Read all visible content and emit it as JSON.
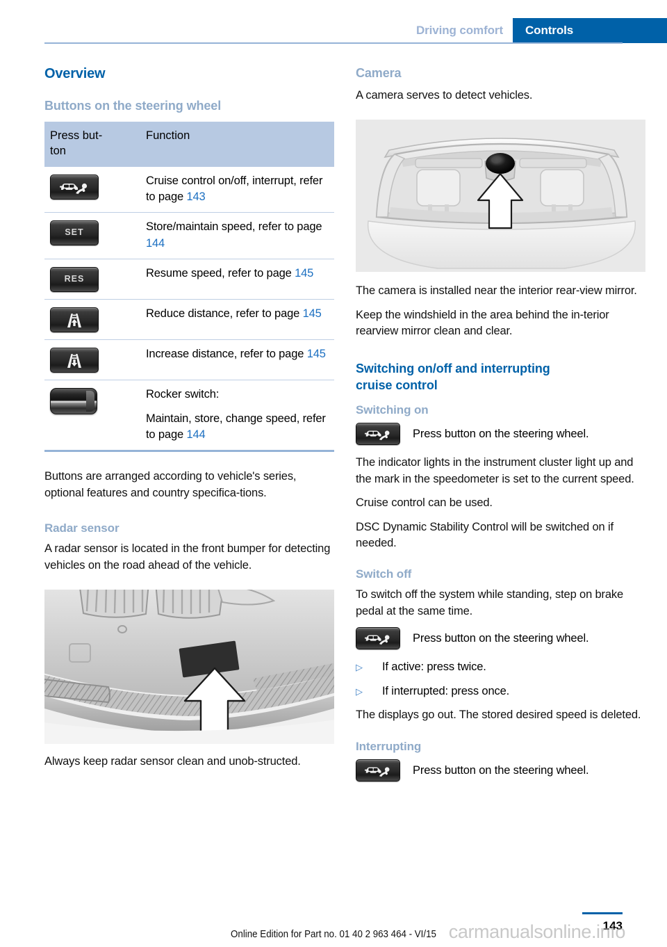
{
  "header": {
    "breadcrumb_inactive": "Driving comfort",
    "breadcrumb_active": "Controls"
  },
  "left_column": {
    "title": "Overview",
    "section_heading": "Buttons on the steering wheel",
    "table": {
      "columns": [
        "Press but-\nton",
        "Function"
      ],
      "col_button_header": "Press but-ton",
      "col_function_header": "Function",
      "rows": [
        {
          "icon": "cruise-control-icon",
          "icon_label": "",
          "text_before": "Cruise control on/off, interrupt, refer to page ",
          "page_ref": "143",
          "text_after": ""
        },
        {
          "icon": "set-button-icon",
          "icon_label": "SET",
          "text_before": "Store/maintain speed, refer to page ",
          "page_ref": "144",
          "text_after": ""
        },
        {
          "icon": "res-button-icon",
          "icon_label": "RES",
          "text_before": "Resume speed, refer to page ",
          "page_ref": "145",
          "text_after": ""
        },
        {
          "icon": "reduce-distance-icon",
          "icon_label": "",
          "text_before": "Reduce distance, refer to page ",
          "page_ref": "145",
          "text_after": ""
        },
        {
          "icon": "increase-distance-icon",
          "icon_label": "",
          "text_before": "Increase distance, refer to page ",
          "page_ref": "145",
          "text_after": ""
        },
        {
          "icon": "rocker-switch-icon",
          "icon_label": "",
          "text_before": "Rocker switch:",
          "page_ref": "144",
          "text_after": "Maintain, store, change speed, refer to page "
        }
      ]
    },
    "paragraph_after_table": "Buttons are arranged according to vehicle's series, optional features and country specifica-tions.",
    "radar_heading": "Radar sensor",
    "radar_paragraph": "A radar sensor is located in the front bumper for detecting vehicles on the road ahead of the vehicle.",
    "radar_caption": "Always keep radar sensor clean and unob-structed.",
    "radar_figure_alt": "front-bumper-radar-sensor-illustration"
  },
  "right_column": {
    "camera_heading": "Camera",
    "camera_intro": "A camera serves to detect vehicles.",
    "camera_figure_alt": "windshield-camera-location-illustration",
    "camera_paragraph_1": "The camera is installed near the interior rear-view mirror.",
    "camera_paragraph_2": "Keep the windshield in the area behind the in-terior rearview mirror clean and clear.",
    "switching_heading": "Switching on/off and interrupting cruise control",
    "switching_on": {
      "heading": "Switching on",
      "icon": "cruise-control-icon",
      "icon_caption": "Press button on the steering wheel.",
      "paragraph_1": "The indicator lights in the instrument cluster light up and the mark in the speedometer is set to the current speed.",
      "paragraph_2": "Cruise control can be used.",
      "paragraph_3": "DSC Dynamic Stability Control will be switched on if needed."
    },
    "switch_off": {
      "heading": "Switch off",
      "paragraph_1": "To switch off the system while standing, step on brake pedal at the same time.",
      "icon": "cruise-control-icon",
      "icon_caption": "Press button on the steering wheel.",
      "bullets": [
        "If active: press twice.",
        "If interrupted: press once."
      ],
      "paragraph_2": "The displays go out. The stored desired speed is deleted."
    },
    "interrupting": {
      "heading": "Interrupting",
      "icon": "cruise-control-icon",
      "icon_caption": "Press button on the steering wheel."
    }
  },
  "footer": {
    "note": "Online Edition for Part no. 01 40 2 963 464 - VI/15",
    "page_number": "143",
    "watermark": "carmanualsonline.info"
  },
  "colors": {
    "accent_blue": "#0061a8",
    "light_blue_heading": "#8faac8",
    "table_header_bg": "#b7c9e2",
    "rule_blue": "#95b3d7",
    "page_ref_link": "#1b6fc1"
  }
}
